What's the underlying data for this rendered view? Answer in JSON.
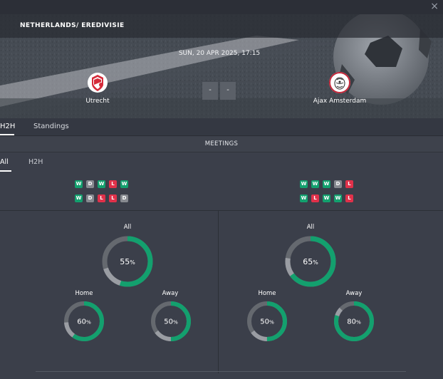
{
  "header": {
    "close_icon": "close-icon"
  },
  "match": {
    "league": "NETHERLANDS/ EREDIVISIE",
    "date": "SUN, 20 APR 2025, 17:15",
    "home_team": "Utrecht",
    "away_team": "Ajax Amsterdam",
    "home_score": "-",
    "away_score": "-"
  },
  "tabs": [
    {
      "label": "H2H",
      "active": true
    },
    {
      "label": "Standings",
      "active": false
    }
  ],
  "section": {
    "title": "MEETINGS"
  },
  "subtabs": [
    {
      "label": "All",
      "active": true
    },
    {
      "label": "H2H",
      "active": false
    }
  ],
  "form": {
    "home": [
      [
        "W",
        "D",
        "W",
        "L",
        "W"
      ],
      [
        "W",
        "D",
        "L",
        "L",
        "D"
      ]
    ],
    "away": [
      [
        "W",
        "W",
        "W",
        "D",
        "L"
      ],
      [
        "W",
        "L",
        "W",
        "W",
        "L"
      ]
    ]
  },
  "stats": {
    "home": {
      "all_label": "All",
      "all": 55,
      "home_label": "Home",
      "home": 60,
      "away_label": "Away",
      "away": 50
    },
    "away": {
      "all_label": "All",
      "all": 65,
      "home_label": "Home",
      "home": 50,
      "away_label": "Away",
      "away": 80
    }
  },
  "colors": {
    "win": "#13a06e",
    "draw": "#878a90",
    "loss": "#e0314a",
    "ring_track": "#65696f",
    "ring_track_light": "#9a9da3",
    "ring_fill": "#13a06e"
  }
}
